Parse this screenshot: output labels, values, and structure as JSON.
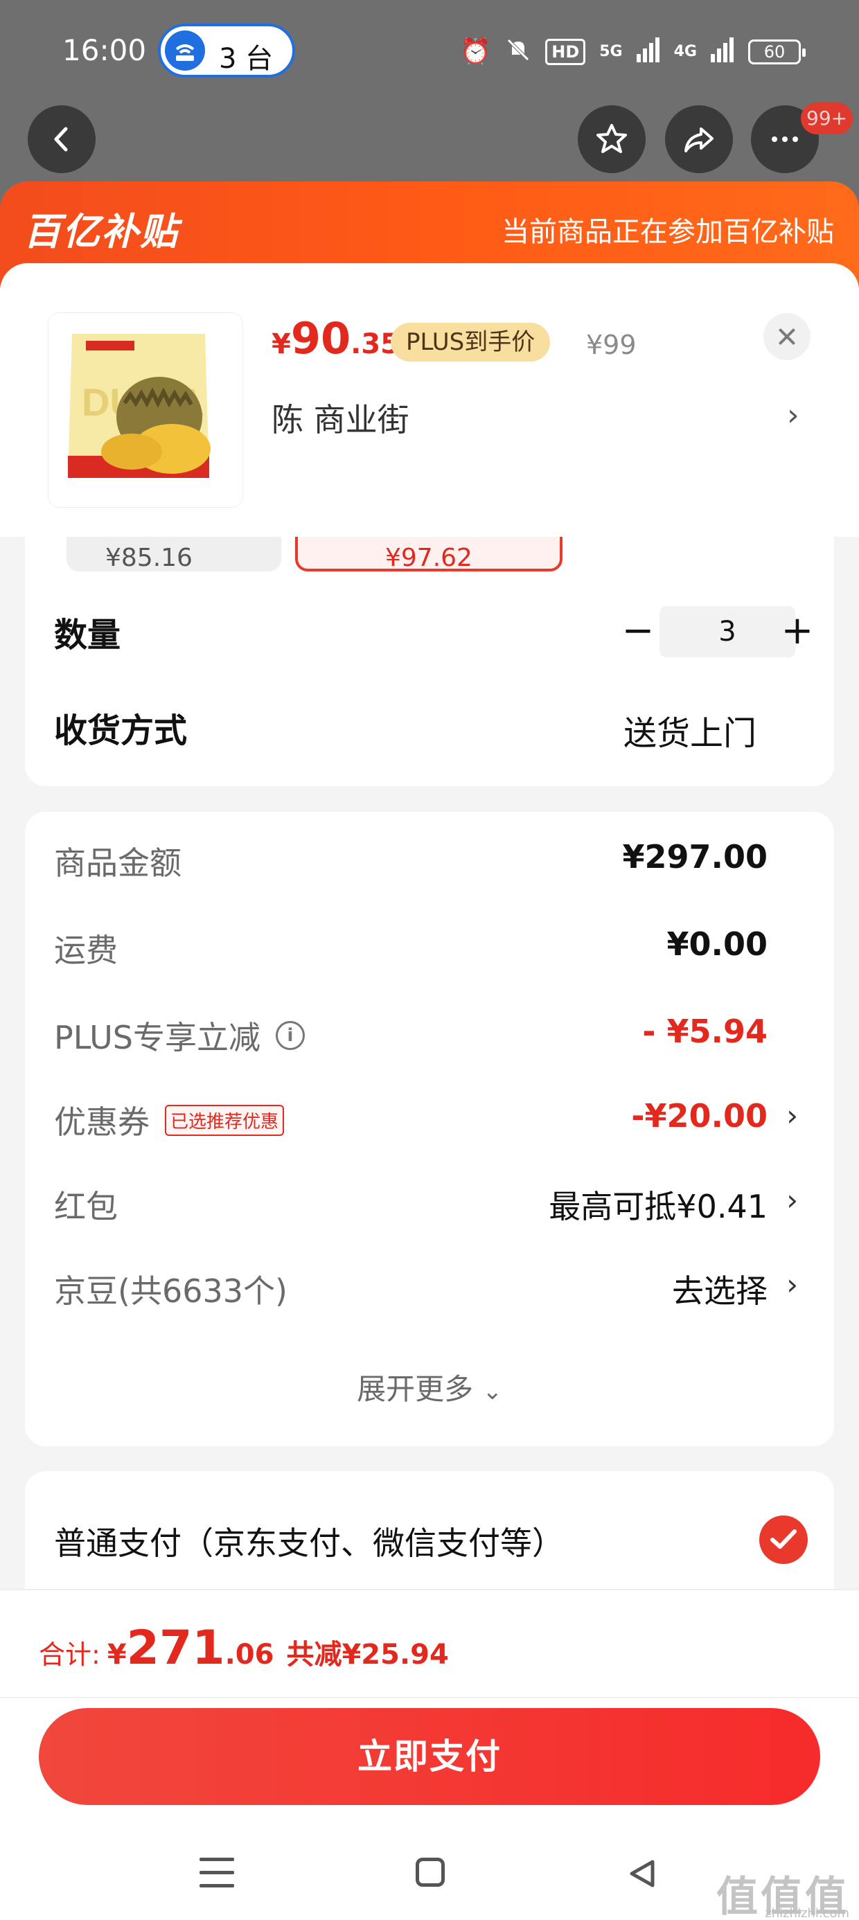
{
  "status_bar": {
    "time": "16:00",
    "pill_label": "3 台",
    "network_tag": "HD",
    "signal_1": "5G",
    "signal_2": "4G",
    "battery": "60"
  },
  "nav": {
    "badge": "99+"
  },
  "banner": {
    "logo": "百亿补贴",
    "text": "当前商品正在参加百亿补贴"
  },
  "product": {
    "price_symbol": "¥",
    "price_int": "90",
    "price_dec": ".35",
    "plus_tag": "PLUS到手价",
    "original_price": "¥99",
    "address": "陈  商业街",
    "peek_option_1": "¥85.16",
    "peek_option_2": "¥97.62"
  },
  "order": {
    "quantity_label": "数量",
    "quantity_value": "3",
    "quantity_minus": "−",
    "quantity_plus": "+",
    "shipping_label": "收货方式",
    "shipping_value": "送货上门"
  },
  "fees": {
    "goods_label": "商品金额",
    "goods_value": "¥297.00",
    "freight_label": "运费",
    "freight_value": "¥0.00",
    "plus_label": "PLUS专享立减",
    "plus_value": "- ¥5.94",
    "coupon_label": "优惠券",
    "coupon_tag": "已选推荐优惠",
    "coupon_value": "-¥20.00",
    "redpacket_label": "红包",
    "redpacket_value": "最高可抵¥0.41",
    "jingdou_label": "京豆(共6633个)",
    "jingdou_value": "去选择",
    "expand": "展开更多"
  },
  "payment": {
    "method": "普通支付（京东支付、微信支付等）"
  },
  "bottom": {
    "total_label": "合计:",
    "total_symbol": "¥",
    "total_int": "271",
    "total_dec": ".06",
    "total_saving": "共减¥25.94",
    "pay_button": "立即支付"
  },
  "watermark": {
    "text": "值值值",
    "sub": "zhizhizhi.com"
  },
  "colors": {
    "accent_red": "#e3291e",
    "banner_orange": "#ff5a16",
    "plus_gold": "#f8df9f"
  }
}
